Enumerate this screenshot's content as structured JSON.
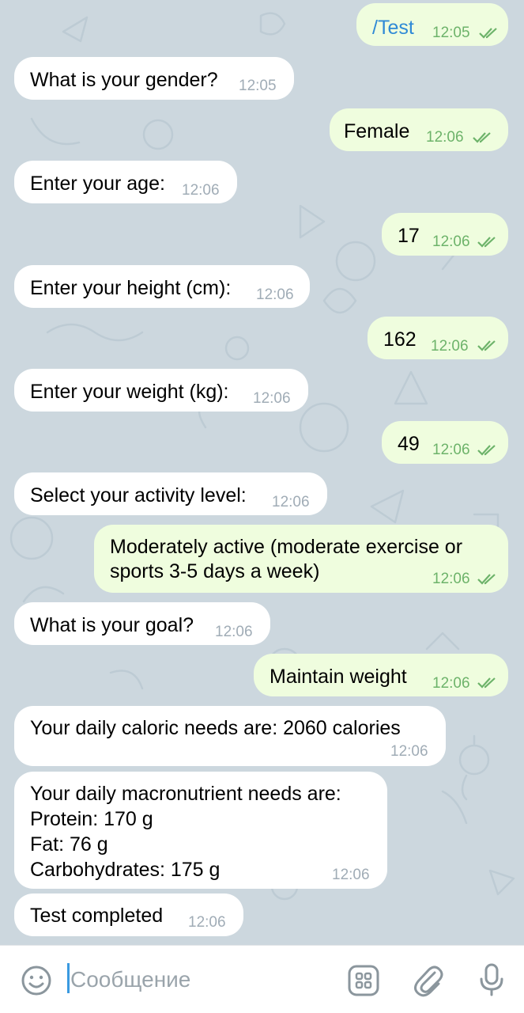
{
  "colors": {
    "chat_background": "#ccd7de",
    "incoming_bubble": "#ffffff",
    "outgoing_bubble": "#effdde",
    "outgoing_time": "#6db36a",
    "incoming_time": "#a0acb6",
    "link": "#2f8ad6"
  },
  "messages": [
    {
      "dir": "out",
      "text": "/Test",
      "time": "12:05",
      "read": true
    },
    {
      "dir": "in",
      "text": "What is your gender?",
      "time": "12:05"
    },
    {
      "dir": "out",
      "text": "Female",
      "time": "12:06",
      "read": true
    },
    {
      "dir": "in",
      "text": "Enter your age:",
      "time": "12:06"
    },
    {
      "dir": "out",
      "text": "17",
      "time": "12:06",
      "read": true
    },
    {
      "dir": "in",
      "text": "Enter your height (cm):",
      "time": "12:06"
    },
    {
      "dir": "out",
      "text": "162",
      "time": "12:06",
      "read": true
    },
    {
      "dir": "in",
      "text": "Enter your weight (kg):",
      "time": "12:06"
    },
    {
      "dir": "out",
      "text": "49",
      "time": "12:06",
      "read": true
    },
    {
      "dir": "in",
      "text": "Select your activity level:",
      "time": "12:06"
    },
    {
      "dir": "out",
      "text_line1": "Moderately active (moderate exercise or",
      "text_line2": "sports 3-5 days a week)",
      "time": "12:06",
      "read": true
    },
    {
      "dir": "in",
      "text": "What is your goal?",
      "time": "12:06"
    },
    {
      "dir": "out",
      "text": "Maintain weight",
      "time": "12:06",
      "read": true
    },
    {
      "dir": "in",
      "text": "Your daily caloric needs are: 2060 calories",
      "time": "12:06"
    },
    {
      "dir": "in",
      "text_line1": "Your daily macronutrient needs are:",
      "text_line2": "Protein: 170 g",
      "text_line3": "Fat: 76 g",
      "text_line4": "Carbohydrates: 175 g",
      "time": "12:06"
    },
    {
      "dir": "in",
      "text": "Test completed",
      "time": "12:06"
    }
  ],
  "input": {
    "placeholder": "Сообщение",
    "emoji_icon": "emoji-icon",
    "commands_icon": "bot-commands-icon",
    "attach_icon": "paperclip-icon",
    "mic_icon": "microphone-icon"
  }
}
